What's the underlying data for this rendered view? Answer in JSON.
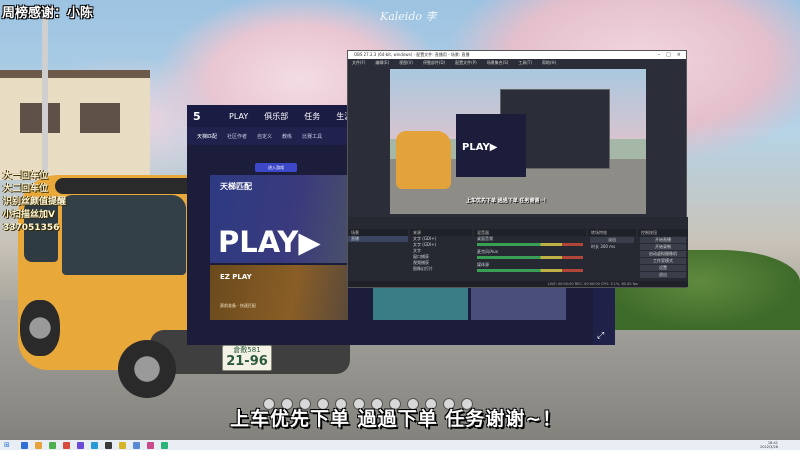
{
  "overlay": {
    "title": "周榜感谢：小陈",
    "list": [
      "大一回车位",
      "大二回车位",
      "识别丝颜值提醒",
      "小扫描丝加V",
      "337051356"
    ],
    "watermark": "Kaleido 李",
    "caption": "上车优先下单 過過下单 任务谢谢~！"
  },
  "car": {
    "plate_top": "倉敷581",
    "plate_num": "21-96"
  },
  "game": {
    "logo": "5",
    "tabs": [
      "PLAY",
      "俱乐部",
      "任务",
      "生涯"
    ],
    "subtabs": [
      "天梯匹配",
      "社区作者",
      "自定义",
      "教练",
      "比赛工具"
    ],
    "badge": "进入游戏",
    "card_title": "天梯匹配",
    "card_play": "PLAY▶",
    "card2_title": "EZ PLAY",
    "card2_sub": "赛前准备 · 快速匹配",
    "side_chevron": "⤢"
  },
  "obs": {
    "title": "OBS 27.2.3 (64-bit, windows) - 配置文件: 直播用 - 场景: 直播",
    "menus": [
      "文件(F)",
      "编辑(E)",
      "视图(V)",
      "停靠部件(D)",
      "配置文件(P)",
      "场景集合(S)",
      "工具(T)",
      "帮助(H)"
    ],
    "preview_game": "PLAY▶",
    "preview_caption": "上车优先下单 過過下单 任务谢谢~！",
    "panel_heads": [
      "场景",
      "来源",
      "混音器",
      "转场特效",
      "控制按钮"
    ],
    "scenes": [
      "直播"
    ],
    "sources": [
      "文字 (GDI+)",
      "文字 (GDI+)",
      "文字",
      "窗口捕获",
      "视频捕获",
      "图像幻灯片"
    ],
    "mixer": [
      "桌面音频",
      "麦克风/Aux",
      "媒体源"
    ],
    "transition": [
      "淡出",
      "时长 300 ms"
    ],
    "controls": [
      "开始直播",
      "开始录制",
      "启动虚拟摄像机",
      "工作室模式",
      "设置",
      "退出"
    ],
    "status": "LIVE: 00:00:00  REC: 00:00:00  CPU: 3.1%, 60.00 fps"
  },
  "taskbar": {
    "start_icon": "⊞",
    "clock_time": "18:41",
    "clock_date": "2022/3/26",
    "icons": [
      "#2f6fd6",
      "#e8a23a",
      "#4caf50",
      "#d84a3a",
      "#6a4ad6",
      "#2a9ad6",
      "#3a3a3a",
      "#d6b42a",
      "#5a8ad6",
      "#c94a8a",
      "#2ab47a"
    ]
  }
}
